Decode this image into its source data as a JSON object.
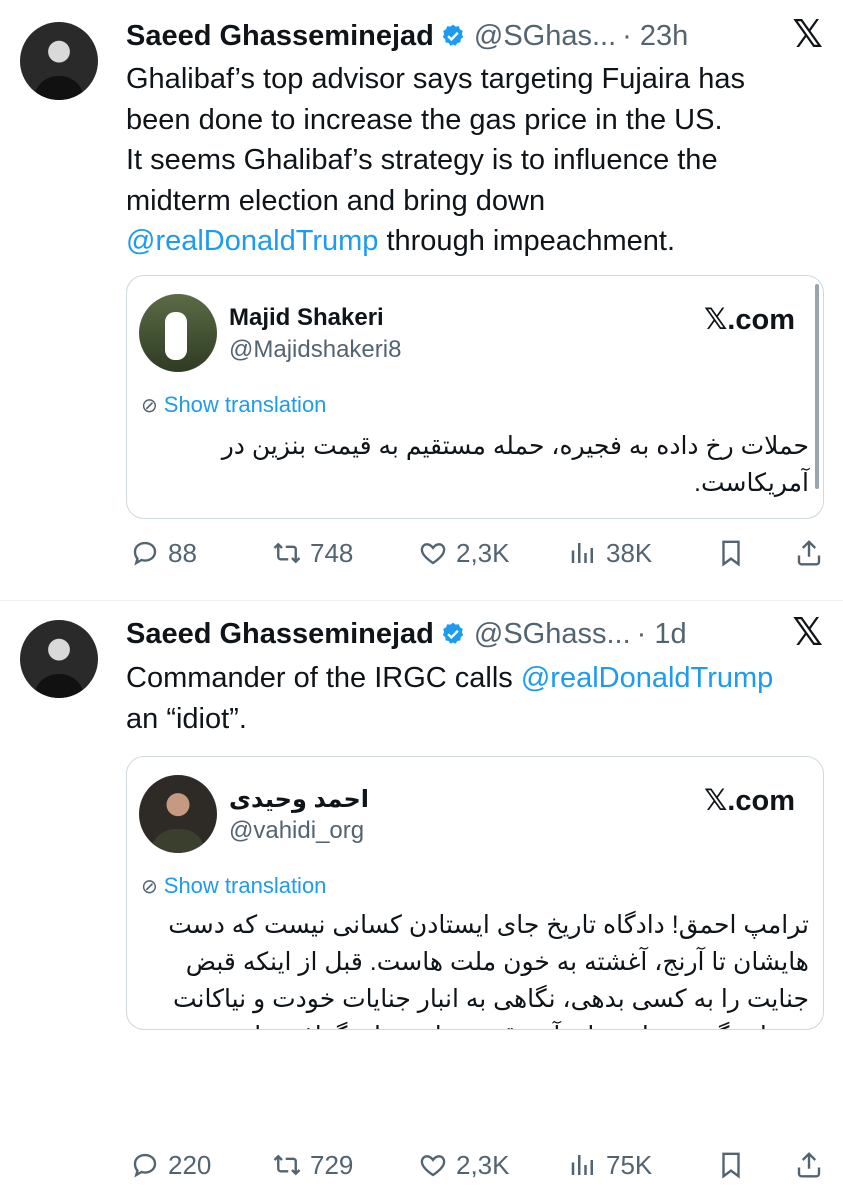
{
  "tweets": [
    {
      "author_name": "Saeed Ghasseminejad",
      "handle": "@SGhas...",
      "time": "· 23h",
      "text_line1": "Ghalibaf’s top advisor says targeting Fujaira has",
      "text_line2": "been done to increase the gas price in the US.",
      "text_line3": "It seems Ghalibaf’s strategy is to influence the",
      "text_line4": "midterm election and bring down",
      "mention": "@realDonaldTrump",
      "text_line5_rest": " through impeachment.",
      "quote": {
        "name": "Majid Shakeri",
        "handle": "@Majidshakeri8",
        "domain": "𝕏.com",
        "show_translation": "Show translation",
        "text": "حملات رخ داده به فجیره، حمله مستقیم به قیمت بنزین در آمریکاست."
      },
      "replies": "88",
      "reposts": "748",
      "likes": "2,3K",
      "views": "38K"
    },
    {
      "author_name": "Saeed Ghasseminejad",
      "handle": "@SGhass...",
      "time": "· 1d",
      "text_prefix": "Commander of the IRGC calls ",
      "mention": "@realDonaldTrump",
      "text_line2": "an “idiot”.",
      "quote": {
        "name": "احمد وحیدی",
        "handle": "@vahidi_org",
        "domain": "𝕏.com",
        "show_translation": "Show translation",
        "text": "ترامپ احمق! دادگاه تاریخ جای ایستادن کسانی نیست که دست هایشان تا آرنج، آغشته به خون ملت هاست. قبل از اینکه قبض جنایت را به کسی بدهی، نگاهی به انبار جنایات خودت و نیاکانت در واشنگتن بینداز. شاید آن وقت دریابی بهای گزاف برازنده کیست."
      },
      "replies": "220",
      "reposts": "729",
      "likes": "2,3K",
      "views": "75K"
    }
  ],
  "colors": {
    "accent": "#1d9bf0",
    "secondary_text": "#536471",
    "border": "#cfd9de"
  },
  "icons": [
    "verified-badge-icon",
    "x-logo-icon",
    "reply-icon",
    "repost-icon",
    "like-icon",
    "views-icon",
    "bookmark-icon",
    "share-icon",
    "translate-icon"
  ]
}
